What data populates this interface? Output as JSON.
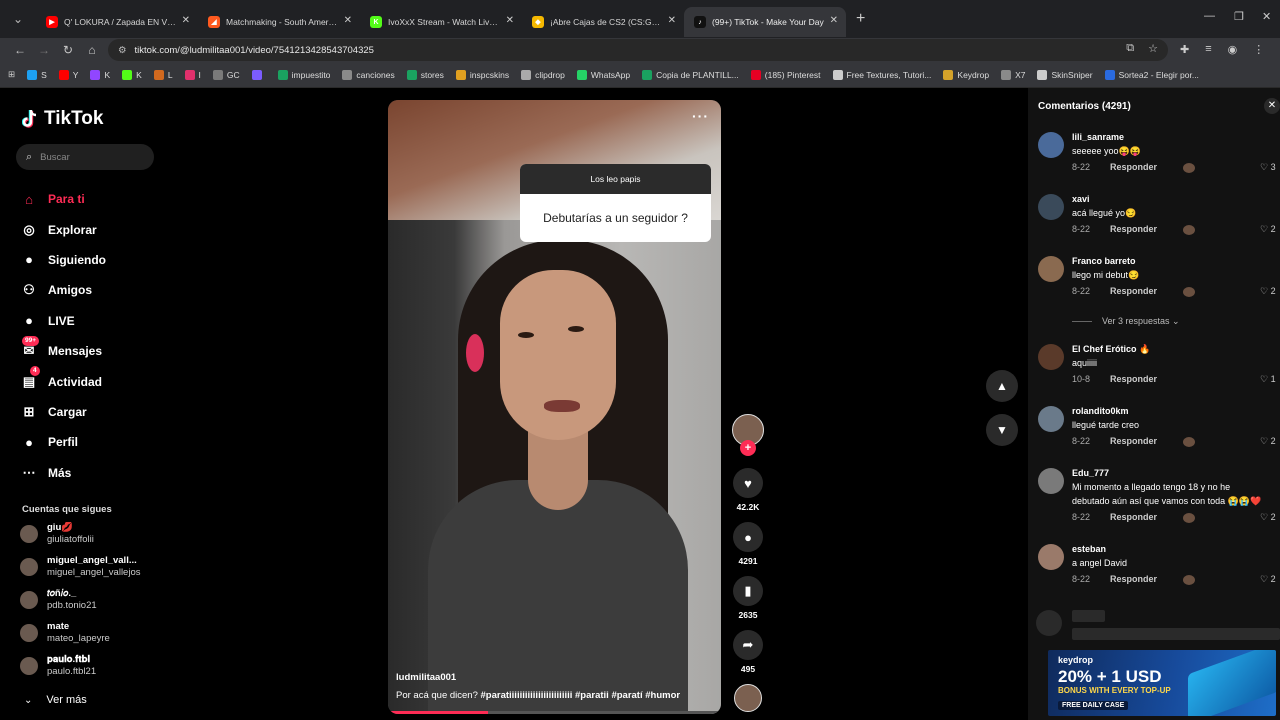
{
  "browser": {
    "tabs": [
      {
        "title": "Q' LOKURA / Zapada EN VIVO",
        "color": "#ff0000",
        "glyph": "▶",
        "active": false
      },
      {
        "title": "Matchmaking - South America",
        "color": "#ff5a1f",
        "glyph": "◢",
        "active": false
      },
      {
        "title": "IvoXxX Stream - Watch Live on",
        "color": "#53fc18",
        "glyph": "K",
        "active": false
      },
      {
        "title": "¡Abre Cajas de CS2 (CS:GO), Ga",
        "color": "#f5b800",
        "glyph": "◆",
        "active": false
      },
      {
        "title": "(99+) TikTok - Make Your Day",
        "color": "#111111",
        "glyph": "♪",
        "active": true
      }
    ],
    "url": "tiktok.com/@ludmilitaa001/video/7541213428543704325",
    "bookmarks": [
      {
        "label": "S",
        "color": "#1da1f2"
      },
      {
        "label": "Y",
        "color": "#ff0000"
      },
      {
        "label": "K",
        "color": "#9146ff"
      },
      {
        "label": "K",
        "color": "#53fc18"
      },
      {
        "label": "L",
        "color": "#d2691e"
      },
      {
        "label": "I",
        "color": "#e1306c"
      },
      {
        "label": "GC",
        "color": "#7a7a7a"
      },
      {
        "label": "",
        "color": "#7b5cff"
      },
      {
        "label": "impuestito",
        "color": "#1aa260"
      },
      {
        "label": "canciones",
        "color": "#8a8a8a"
      },
      {
        "label": "stores",
        "color": "#1aa260"
      },
      {
        "label": "inspcskins",
        "color": "#e0a020"
      },
      {
        "label": "clipdrop",
        "color": "#aaaaaa"
      },
      {
        "label": "WhatsApp",
        "color": "#25d366"
      },
      {
        "label": "Copia de PLANTILL...",
        "color": "#1aa260"
      },
      {
        "label": "(185) Pinterest",
        "color": "#e60023"
      },
      {
        "label": "Free Textures, Tutori...",
        "color": "#cccccc"
      },
      {
        "label": "Keydrop",
        "color": "#d4a22a"
      },
      {
        "label": "X7",
        "color": "#8a8a8a"
      },
      {
        "label": "SkinSniper",
        "color": "#cccccc"
      },
      {
        "label": "Sortea2 - Elegir por...",
        "color": "#2a6adf"
      }
    ]
  },
  "tiktok": {
    "logo": "TikTok",
    "search_placeholder": "Buscar",
    "nav": [
      {
        "label": "Para ti",
        "icon": "home-icon",
        "glyph": "⌂"
      },
      {
        "label": "Explorar",
        "icon": "compass-icon",
        "glyph": "◎"
      },
      {
        "label": "Siguiendo",
        "icon": "following-icon",
        "glyph": "●"
      },
      {
        "label": "Amigos",
        "icon": "friends-icon",
        "glyph": "⚇"
      },
      {
        "label": "LIVE",
        "icon": "live-icon",
        "glyph": "●"
      },
      {
        "label": "Mensajes",
        "icon": "messages-icon",
        "glyph": "✉"
      },
      {
        "label": "Actividad",
        "icon": "activity-icon",
        "glyph": "▤"
      },
      {
        "label": "Cargar",
        "icon": "upload-icon",
        "glyph": "⊞"
      },
      {
        "label": "Perfil",
        "icon": "profile-icon",
        "glyph": "●"
      },
      {
        "label": "Más",
        "icon": "more-icon",
        "glyph": "⋯"
      }
    ],
    "messages_badge": "99+",
    "activity_badge": "4",
    "following_title": "Cuentas que sigues",
    "following": [
      {
        "name": "giu💋",
        "handle": "giuliatoffolii"
      },
      {
        "name": "miguel_angel_vall...",
        "handle": "miguel_angel_vallejos"
      },
      {
        "name": "𝑡𝑜ñ𝑖𝑜._",
        "handle": "pdb.tonio21"
      },
      {
        "name": "mate",
        "handle": "mateo_lapeyre"
      },
      {
        "name": "𝐩𝐚𝐮𝐥𝐨.𝐟𝐭𝐛𝐥",
        "handle": "paulo.ftbl21"
      }
    ],
    "see_more": "Ver más"
  },
  "video": {
    "question_header": "Los leo papis",
    "question_body": "Debutarías a un seguidor ?",
    "username": "ludmilitaa001",
    "caption_text": "Por acá que dicen?",
    "hashtags": "#paratiiiiiiiiiiiiiiiiiiiiiiii  #paratii  #paratí  #humor",
    "likes": "42.2K",
    "comments": "4291",
    "saves": "2635",
    "shares": "495",
    "progress": 0.3
  },
  "comments_panel": {
    "title": "Comentarios (4291)",
    "items": [
      {
        "user": "lili_sanrame",
        "text": "seeeee yoo😝😝",
        "date": "8-22",
        "reply": "Responder",
        "likes": "3"
      },
      {
        "user": "xavi",
        "text": "acá llegué yo😏",
        "date": "8-22",
        "reply": "Responder",
        "likes": "2"
      },
      {
        "user": "Franco barreto",
        "text": "llego mi debut😏",
        "date": "8-22",
        "reply": "Responder",
        "likes": "2"
      },
      {
        "user": "El Chef Erótico 🔥",
        "text": "aquiiiii",
        "date": "10-8",
        "reply": "Responder",
        "likes": "1"
      },
      {
        "user": "rolandito0km",
        "text": "llegué tarde creo",
        "date": "8-22",
        "reply": "Responder",
        "likes": "2"
      },
      {
        "user": "Edu_777",
        "text": "Mi momento a llegado tengo 18 y no he",
        "text2": "debutado aún así que vamos con toda 😭😭❤️",
        "date": "8-22",
        "reply": "Responder",
        "likes": "2"
      },
      {
        "user": "esteban",
        "text": "a angel David",
        "date": "8-22",
        "reply": "Responder",
        "likes": "2"
      }
    ],
    "view_replies": "Ver 3 respuestas ⌄"
  },
  "ad": {
    "brand": "keydrop",
    "headline": "20% + 1 USD",
    "sub": "BONUS WITH EVERY TOP-UP",
    "cta": "FREE DAILY CASE"
  },
  "colors": {
    "accent": "#fe2c55"
  }
}
